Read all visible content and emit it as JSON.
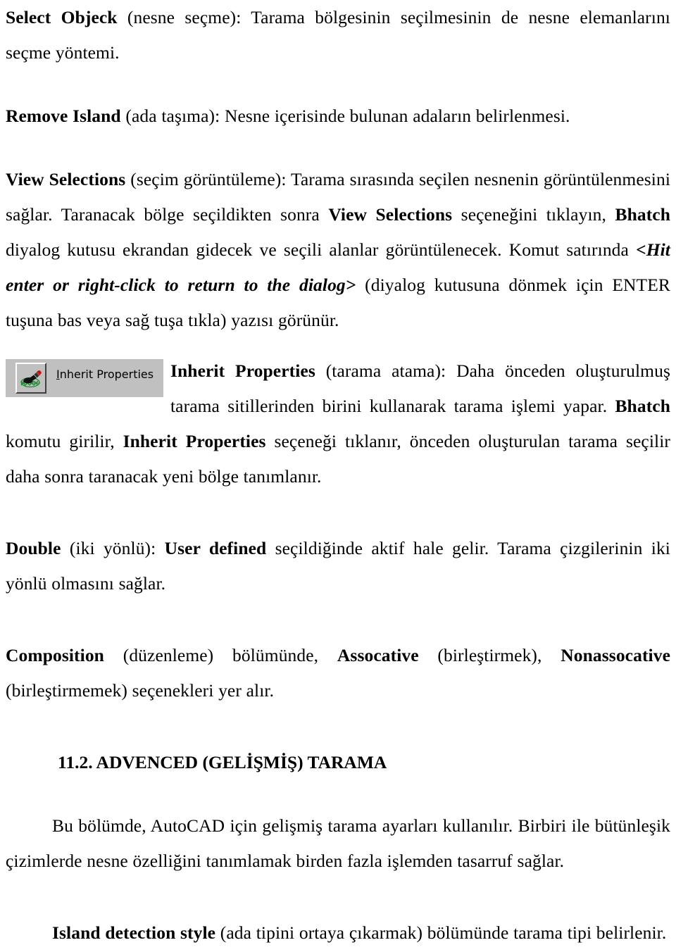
{
  "document": {
    "language": "tr",
    "page_background": "#ffffff",
    "text_color": "#000000"
  },
  "paragraphs": {
    "select_objeck": {
      "term": "Select Objeck",
      "rest": " (nesne seçme): Tarama bölgesinin seçilmesinin de nesne elemanlarını seçme yöntemi."
    },
    "remove_island": {
      "term": "Remove Island",
      "rest": " (ada taşıma): Nesne içerisinde bulunan adaların belirlenmesi."
    },
    "view_selections": {
      "term": "View Selections",
      "part1": " (seçim görüntüleme): Tarama sırasında seçilen nesnenin görüntülenmesini sağlar. Taranacak bölge seçildikten sonra ",
      "term2": "View Selections",
      "part2": " seçeneğini tıklayın, ",
      "term3": "Bhatch",
      "part3": " diyalog kutusu ekrandan gidecek ve seçili alanlar görüntülenecek. Komut satırında ",
      "italic": "<Hit enter or right-click to return to the dialog>",
      "part4": " (diyalog kutusuna dönmek için ENTER tuşuna bas veya sağ tuşa tıkla) yazısı görünür."
    },
    "inherit_properties": {
      "term": "Inherit Properties",
      "part1": " (tarama atama): Daha önceden oluşturulmuş tarama sitillerinden birini kullanarak tarama işlemi yapar. ",
      "term2": "Bhatch",
      "part2": " komutu girilir, ",
      "term3": "Inherit Properties",
      "part3": " seçeneği tıklanır, önceden oluşturulan tarama seçilir daha sonra taranacak yeni bölge tanımlanır."
    },
    "double": {
      "term": "Double",
      "part1": " (iki yönlü): ",
      "term2": "User defined",
      "part2": " seçildiğinde aktif hale gelir. Tarama çizgilerinin iki yönlü olmasını sağlar."
    },
    "composition": {
      "term": "Composition",
      "part1": " (düzenleme) bölümünde, ",
      "term2": "Assocative",
      "part2": " (birleştirmek), ",
      "term3": "Nonassocative",
      "part3": " (birleştirmemek) seçenekleri yer alır."
    },
    "advanced_body": {
      "text": "Bu bölümde, AutoCAD için gelişmiş tarama ayarları kullanılır. Birbiri ile bütünleşik çizimlerde nesne özelliğini tanımlamak birden fazla işlemden tasarruf sağlar."
    },
    "island_detection": {
      "term": "Island detection style",
      "rest": " (ada tipini ortaya çıkarmak) bölümünde tarama tipi belirlenir."
    }
  },
  "heading": {
    "number": "11.2.",
    "text": "11.2. ADVENCED (GELİŞMİŞ) TARAMA"
  },
  "widget": {
    "label_prefix": "I",
    "label_rest": "nherit Properties",
    "icon_name": "paintbrush-hatch-icon",
    "colors": {
      "face": "#c0c0c0",
      "highlight": "#ffffff",
      "shadow": "#404040",
      "brush_handle": "#000000",
      "brush_tip": "#cc2020",
      "hatch": "#1e8a32"
    }
  }
}
